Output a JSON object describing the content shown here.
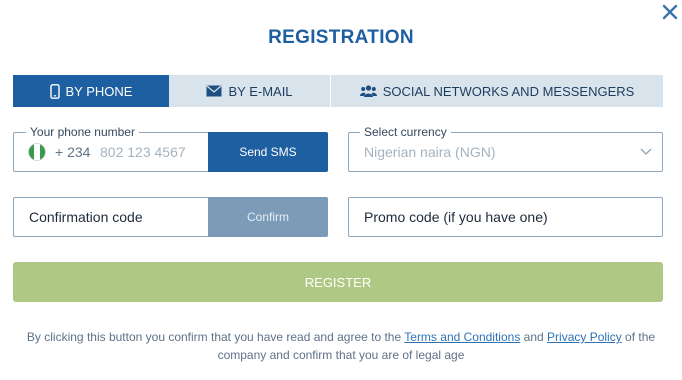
{
  "title": "REGISTRATION",
  "tabs": [
    {
      "label": "BY PHONE",
      "icon": "phone-icon",
      "active": true
    },
    {
      "label": "BY E-MAIL",
      "icon": "envelope-icon",
      "active": false
    },
    {
      "label": "SOCIAL NETWORKS AND MESSENGERS",
      "icon": "users-icon",
      "active": false
    }
  ],
  "phone": {
    "legend": "Your phone number",
    "country_flag": "nigeria-flag-icon",
    "country_code": "+ 234",
    "placeholder": "802 123 4567",
    "send_sms_label": "Send SMS"
  },
  "currency": {
    "legend": "Select currency",
    "selected": "Nigerian naira (NGN)"
  },
  "confirmation": {
    "placeholder": "Confirmation code",
    "confirm_label": "Confirm"
  },
  "promo": {
    "placeholder": "Promo code (if you have one)"
  },
  "register_label": "REGISTER",
  "terms": {
    "part1": "By clicking this button you confirm that you have read and agree to the ",
    "terms_link": "Terms and Conditions",
    "part2": " and ",
    "privacy_link": "Privacy Policy",
    "part3": " of the company and confirm that you are of legal age"
  },
  "colors": {
    "brand": "#1d5fa0",
    "register": "#afc984",
    "confirm": "#7b9bb9"
  }
}
